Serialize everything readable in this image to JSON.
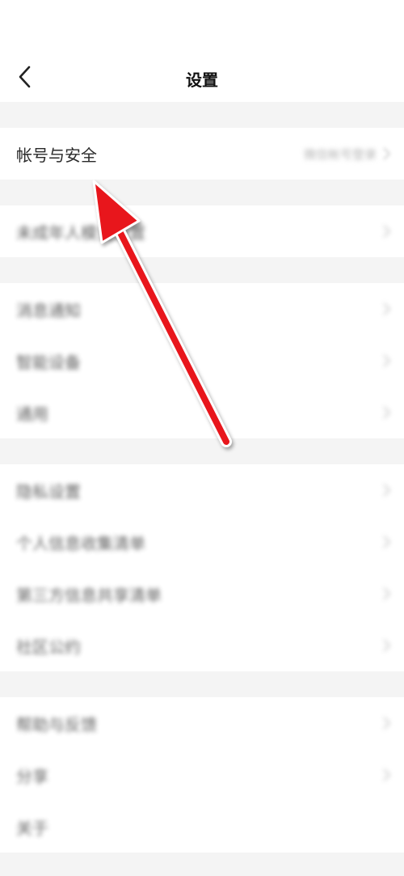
{
  "header": {
    "title": "设置"
  },
  "groups": [
    {
      "items": [
        {
          "label": "帐号与安全",
          "value": "微信帐号登录"
        }
      ]
    },
    {
      "items": [
        {
          "label": "未成年人模式设置"
        }
      ]
    },
    {
      "items": [
        {
          "label": "消息通知"
        },
        {
          "label": "智能设备"
        },
        {
          "label": "通用"
        }
      ]
    },
    {
      "items": [
        {
          "label": "隐私设置"
        },
        {
          "label": "个人信息收集清单"
        },
        {
          "label": "第三方信息共享清单"
        },
        {
          "label": "社区公约"
        }
      ]
    },
    {
      "items": [
        {
          "label": "帮助与反馈"
        },
        {
          "label": "分享"
        },
        {
          "label": "关于"
        }
      ]
    }
  ],
  "icons": {
    "back": "chevron-left-icon",
    "chevron": "chevron-right-icon",
    "annotation": "red-arrow-icon"
  },
  "colors": {
    "annotation_arrow": "#e8141b"
  }
}
